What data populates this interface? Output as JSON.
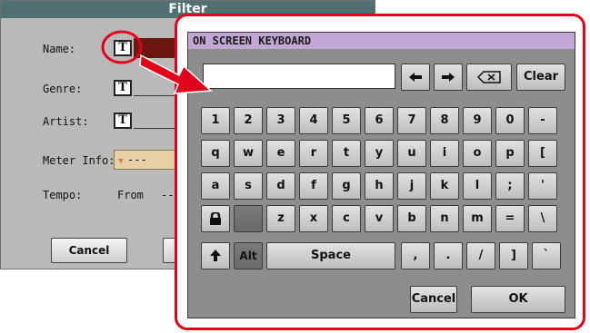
{
  "filter": {
    "title": "Filter",
    "name_label": "Name:",
    "genre_label": "Genre:",
    "artist_label": "Artist:",
    "meter_label": "Meter Info:",
    "tempo_label": "Tempo:",
    "t_glyph": "T",
    "meter_value": "---",
    "tempo_from": "From",
    "tempo_dash": "--",
    "cancel": "Cancel"
  },
  "keyboard": {
    "title": "ON SCREEN KEYBOARD",
    "input_value": "",
    "clear": "Clear",
    "row1": [
      "1",
      "2",
      "3",
      "4",
      "5",
      "6",
      "7",
      "8",
      "9",
      "0",
      "-"
    ],
    "row2": [
      "q",
      "w",
      "e",
      "r",
      "t",
      "y",
      "u",
      "i",
      "o",
      "p",
      "["
    ],
    "row3": [
      "a",
      "s",
      "d",
      "f",
      "g",
      "h",
      "j",
      "k",
      "l",
      ";",
      "'"
    ],
    "row4": [
      "z",
      "x",
      "c",
      "v",
      "b",
      "n",
      "m",
      "=",
      "\\"
    ],
    "alt": "Alt",
    "space": "Space",
    "row5": [
      ",",
      ".",
      "/",
      "]",
      "`"
    ],
    "cancel": "Cancel",
    "ok": "OK"
  },
  "colors": {
    "highlight": "#e2001a",
    "title_bar": "#c1a8d6",
    "filter_title_bar": "#4f6f73"
  },
  "icons": [
    "left-arrow-icon",
    "right-arrow-icon",
    "backspace-icon",
    "lock-icon",
    "shift-up-arrow-icon"
  ]
}
